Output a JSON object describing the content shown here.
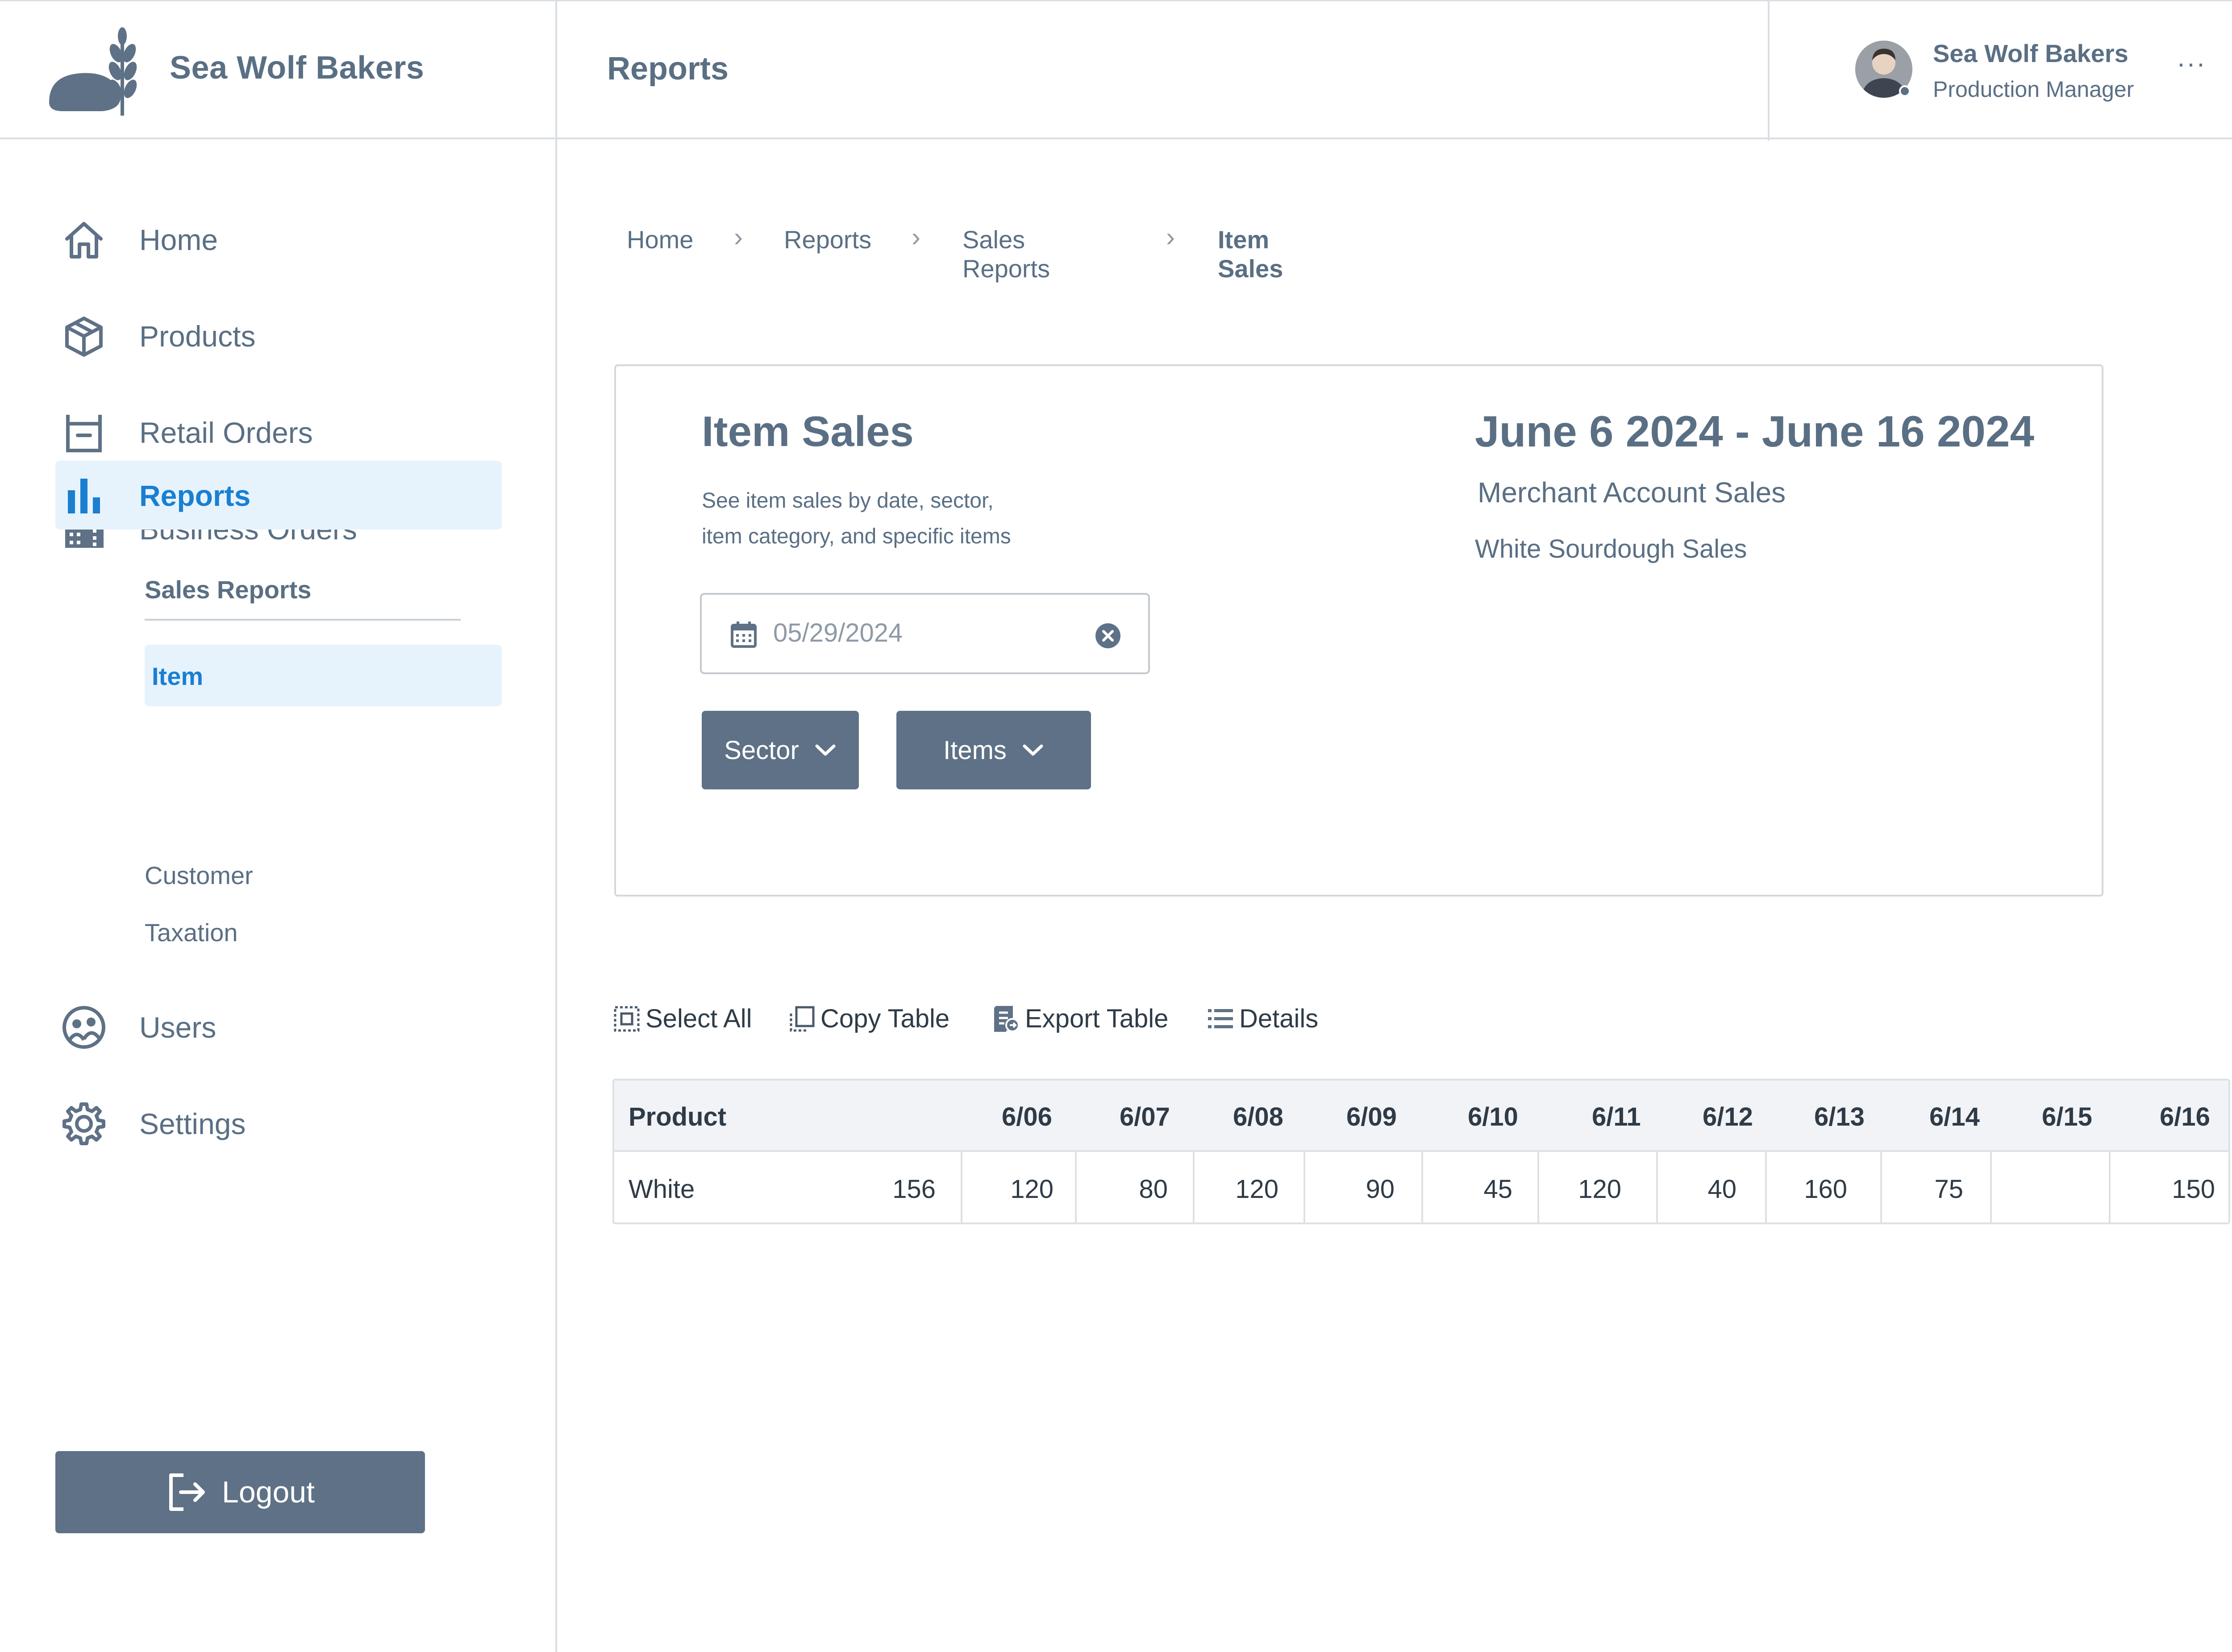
{
  "brand": {
    "name": "Sea Wolf Bakers"
  },
  "header": {
    "title": "Reports"
  },
  "user": {
    "name": "Sea Wolf Bakers",
    "role": "Production Manager",
    "more": "···"
  },
  "sidebar": {
    "items": [
      {
        "label": "Home",
        "icon": "home-icon"
      },
      {
        "label": "Products",
        "icon": "box-icon"
      },
      {
        "label": "Retail Orders",
        "icon": "retail-orders-icon"
      },
      {
        "label": "Business Orders",
        "icon": "building-icon"
      },
      {
        "label": "Reports",
        "icon": "bar-chart-icon",
        "active": true
      },
      {
        "label": "Users",
        "icon": "users-icon"
      },
      {
        "label": "Settings",
        "icon": "gear-icon"
      }
    ],
    "reports_sub": {
      "header": "Sales Reports",
      "items": [
        "Item",
        "Customer",
        "Taxation"
      ],
      "active": "Item"
    },
    "logout_label": "Logout"
  },
  "breadcrumb": [
    "Home",
    "Reports",
    "Sales Reports",
    "Item Sales"
  ],
  "card": {
    "title": "Item Sales",
    "description_line1": "See item sales by date, sector,",
    "description_line2": "item category, and specific items",
    "date_range": "June 6 2024 - June 16 2024",
    "account": "Merchant Account Sales",
    "item_filter": "White Sourdough Sales",
    "date_value": "05/29/2024",
    "sector_label": "Sector",
    "items_label": "Items"
  },
  "toolbar": {
    "select_all": "Select All",
    "copy_table": "Copy Table",
    "export_table": "Export Table",
    "details": "Details"
  },
  "table": {
    "columns": [
      "Product",
      "6/06",
      "6/07",
      "6/08",
      "6/09",
      "6/10",
      "6/11",
      "6/12",
      "6/13",
      "6/14",
      "6/15",
      "6/16"
    ],
    "rows": [
      [
        "White",
        "156",
        "120",
        "80",
        "120",
        "90",
        "45",
        "120",
        "40",
        "160",
        "75",
        "150"
      ]
    ]
  },
  "colors": {
    "primary_text": "#5a6f84",
    "accent": "#1a7fd1",
    "active_bg": "#e6f3fd",
    "button_bg": "#5e7186"
  }
}
